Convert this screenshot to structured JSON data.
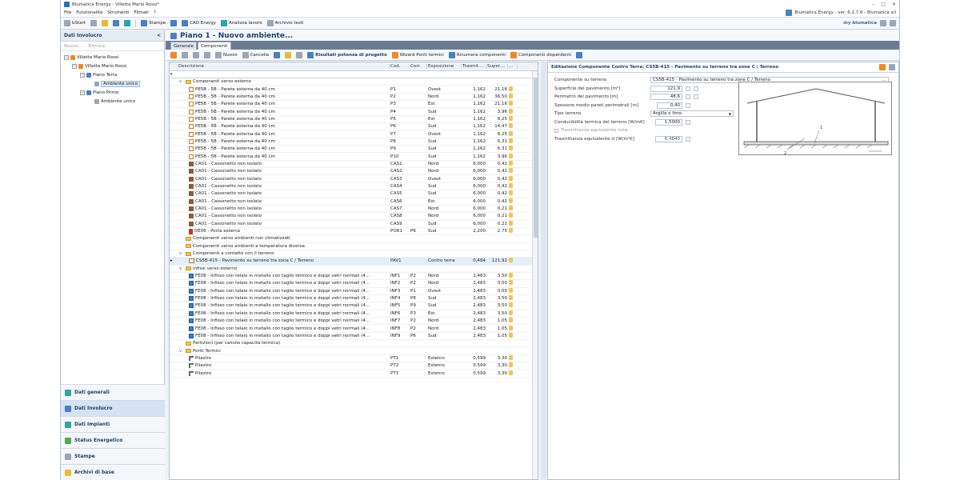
{
  "window": {
    "title": "Blumatica Energy - Villetta Mario Rossi*",
    "controls": [
      "–",
      "□",
      "✕"
    ]
  },
  "menu": {
    "items": [
      "File",
      "Funzionalità",
      "Strumenti",
      "Filmati",
      "?"
    ],
    "version": "Blumatica Energy - ver. 6.2.7.6 - Blumatica srl"
  },
  "toolbar": {
    "start": "bStart",
    "stampe": "Stampe",
    "cad": "CAD Energy",
    "analizza": "Analizza lavoro",
    "archivio": "Archivio testi",
    "brand": "my blumatica"
  },
  "left": {
    "header": "Dati Involucro",
    "collapse": "<",
    "nuovo": "Nuovo...",
    "elimina": "Elimina",
    "tree": [
      {
        "label": "Villetta Mario Rossi",
        "level": 0,
        "exp": "−"
      },
      {
        "label": "Villetta Mario Rossi",
        "level": 1,
        "exp": "−"
      },
      {
        "label": "Piano Terra",
        "level": 2,
        "exp": "−"
      },
      {
        "label": "Ambiente unico",
        "level": 3,
        "exp": "",
        "selected": true
      },
      {
        "label": "Piano Primo",
        "level": 2,
        "exp": "−"
      },
      {
        "label": "Ambiente unico",
        "level": 3,
        "exp": ""
      }
    ],
    "nav": [
      "Dati generali",
      "Dati Involucro",
      "Dati Impianti",
      "Status Energetico",
      "Stampe",
      "Archivi di base"
    ],
    "nav_active": 1
  },
  "main": {
    "title": "Piano 1 - Nuovo ambiente...",
    "tabs": [
      "Generale",
      "Componenti"
    ],
    "active_tab": 1,
    "toolbar": [
      "Nuovo",
      "Cancella",
      "Risultati potenza di progetto",
      "Wizard Ponti termici",
      "Rinumera componenti",
      "Componenti disperdenti"
    ]
  },
  "grid": {
    "headers": [
      "Descrizione",
      "Cod.",
      "Corr.",
      "Esposizione",
      "Trasmit....",
      "Super....",
      "..."
    ],
    "rows": [
      {
        "type": "group",
        "exp": "v",
        "desc": "Componenti verso esterno"
      },
      {
        "type": "wall",
        "desc": "PE5B - 5B - Parete esterna da 40 cm",
        "cod": "P1",
        "corr": "",
        "esp": "Ovest",
        "tr": "1,162",
        "sup": "21,16"
      },
      {
        "type": "wall",
        "desc": "PE5B - 5B - Parete esterna da 40 cm",
        "cod": "P2",
        "corr": "",
        "esp": "Nord",
        "tr": "1,162",
        "sup": "36,50"
      },
      {
        "type": "wall",
        "desc": "PE5B - 5B - Parete esterna da 40 cm",
        "cod": "P3",
        "corr": "",
        "esp": "Est",
        "tr": "1,162",
        "sup": "21,16"
      },
      {
        "type": "wall",
        "desc": "PE5B - 5B - Parete esterna da 40 cm",
        "cod": "P4",
        "corr": "",
        "esp": "Sud",
        "tr": "1,162",
        "sup": "3,96"
      },
      {
        "type": "wall",
        "desc": "PE5B - 5B - Parete esterna da 40 cm",
        "cod": "P5",
        "corr": "",
        "esp": "Est",
        "tr": "1,162",
        "sup": "8,25"
      },
      {
        "type": "wall",
        "desc": "PE5B - 5B - Parete esterna da 40 cm",
        "cod": "P6",
        "corr": "",
        "esp": "Sud",
        "tr": "1,162",
        "sup": "14,47"
      },
      {
        "type": "wall",
        "desc": "PE5B - 5B - Parete esterna da 40 cm",
        "cod": "P7",
        "corr": "",
        "esp": "Ovest",
        "tr": "1,162",
        "sup": "8,25"
      },
      {
        "type": "wall",
        "desc": "PE5B - 5B - Parete esterna da 40 cm",
        "cod": "P8",
        "corr": "",
        "esp": "Sud",
        "tr": "1,162",
        "sup": "6,31"
      },
      {
        "type": "wall",
        "desc": "PE5B - 5B - Parete esterna da 40 cm",
        "cod": "P9",
        "corr": "",
        "esp": "Sud",
        "tr": "1,162",
        "sup": "6,31"
      },
      {
        "type": "wall",
        "desc": "PE5B - 5B - Parete esterna da 40 cm",
        "cod": "P10",
        "corr": "",
        "esp": "Sud",
        "tr": "1,162",
        "sup": "3,96"
      },
      {
        "type": "box",
        "desc": "CA01 - Cassonetto non isolato",
        "cod": "CAS1",
        "corr": "",
        "esp": "Nord",
        "tr": "6,000",
        "sup": "0,42"
      },
      {
        "type": "box",
        "desc": "CA01 - Cassonetto non isolato",
        "cod": "CAS2",
        "corr": "",
        "esp": "Nord",
        "tr": "6,000",
        "sup": "0,42"
      },
      {
        "type": "box",
        "desc": "CA01 - Cassonetto non isolato",
        "cod": "CAS3",
        "corr": "",
        "esp": "Ovest",
        "tr": "6,000",
        "sup": "0,42"
      },
      {
        "type": "box",
        "desc": "CA01 - Cassonetto non isolato",
        "cod": "CAS4",
        "corr": "",
        "esp": "Sud",
        "tr": "6,000",
        "sup": "0,42"
      },
      {
        "type": "box",
        "desc": "CA01 - Cassonetto non isolato",
        "cod": "CAS5",
        "corr": "",
        "esp": "Sud",
        "tr": "6,000",
        "sup": "0,42"
      },
      {
        "type": "box",
        "desc": "CA01 - Cassonetto non isolato",
        "cod": "CAS6",
        "corr": "",
        "esp": "Est",
        "tr": "6,000",
        "sup": "0,42"
      },
      {
        "type": "box",
        "desc": "CA01 - Cassonetto non isolato",
        "cod": "CAS7",
        "corr": "",
        "esp": "Nord",
        "tr": "6,000",
        "sup": "0,21"
      },
      {
        "type": "box",
        "desc": "CA01 - Cassonetto non isolato",
        "cod": "CAS8",
        "corr": "",
        "esp": "Nord",
        "tr": "6,000",
        "sup": "0,21"
      },
      {
        "type": "box",
        "desc": "CA01 - Cassonetto non isolato",
        "cod": "CAS9",
        "corr": "",
        "esp": "Sud",
        "tr": "6,000",
        "sup": "0,21"
      },
      {
        "type": "door",
        "desc": "DE06 - Porta esterna",
        "cod": "POR1",
        "corr": "P6",
        "esp": "Sud",
        "tr": "2,200",
        "sup": "2,75"
      },
      {
        "type": "group",
        "exp": "",
        "desc": "Componenti verso ambienti non climatizzati"
      },
      {
        "type": "group",
        "exp": "",
        "desc": "Componenti verso ambienti a temperatura diversa"
      },
      {
        "type": "group",
        "exp": "v",
        "desc": "Componenti a contatto con il terreno"
      },
      {
        "type": "floor",
        "selected": true,
        "desc": "CS5B-415 - Pavimento su terreno tra zone C / Terreno",
        "cod": "PAV1",
        "corr": "",
        "esp": "Contro terra",
        "tr": "0,484",
        "sup": "121,92"
      },
      {
        "type": "group",
        "exp": "v",
        "desc": "Infissi verso esterno"
      },
      {
        "type": "win",
        "desc": "FE08 - Infisso con telaio in metallo con taglio termico e doppi vetri normali (4...",
        "cod": "INF1",
        "corr": "P2",
        "esp": "Nord",
        "tr": "2,483",
        "sup": "3,50"
      },
      {
        "type": "win",
        "desc": "FE08 - Infisso con telaio in metallo con taglio termico e doppi vetri normali (4...",
        "cod": "INF2",
        "corr": "P2",
        "esp": "Nord",
        "tr": "2,483",
        "sup": "3,50"
      },
      {
        "type": "win",
        "desc": "FE08 - Infisso con telaio in metallo con taglio termico e doppi vetri normali (4...",
        "cod": "INF3",
        "corr": "P1",
        "esp": "Ovest",
        "tr": "2,483",
        "sup": "3,50"
      },
      {
        "type": "win",
        "desc": "FE08 - Infisso con telaio in metallo con taglio termico e doppi vetri normali (4...",
        "cod": "INF4",
        "corr": "P8",
        "esp": "Sud",
        "tr": "2,483",
        "sup": "3,50"
      },
      {
        "type": "win",
        "desc": "FE08 - Infisso con telaio in metallo con taglio termico e doppi vetri normali (4...",
        "cod": "INF5",
        "corr": "P9",
        "esp": "Sud",
        "tr": "2,483",
        "sup": "3,50"
      },
      {
        "type": "win",
        "desc": "FE08 - Infisso con telaio in metallo con taglio termico e doppi vetri normali (4...",
        "cod": "INF6",
        "corr": "P3",
        "esp": "Est",
        "tr": "2,483",
        "sup": "3,50"
      },
      {
        "type": "win",
        "desc": "FE08 - Infisso con telaio in metallo con taglio termico e doppi vetri normali (4...",
        "cod": "INF7",
        "corr": "P2",
        "esp": "Nord",
        "tr": "2,483",
        "sup": "1,05"
      },
      {
        "type": "win",
        "desc": "FE08 - Infisso con telaio in metallo con taglio termico e doppi vetri normali (4...",
        "cod": "INF8",
        "corr": "P2",
        "esp": "Nord",
        "tr": "2,483",
        "sup": "1,05"
      },
      {
        "type": "win",
        "desc": "FE08 - Infisso con telaio in metallo con taglio termico e doppi vetri normali (4...",
        "cod": "INF9",
        "corr": "P6",
        "esp": "Sud",
        "tr": "2,483",
        "sup": "1,05"
      },
      {
        "type": "group",
        "exp": "",
        "desc": "Partizioni (per calcolo capacità termica)"
      },
      {
        "type": "group",
        "exp": "v",
        "desc": "Ponti Termici"
      },
      {
        "type": "pil",
        "desc": "Pilastro",
        "cod": "PT1",
        "corr": "",
        "esp": "Esterno",
        "tr": "0,599",
        "sup": "3,30"
      },
      {
        "type": "pil",
        "desc": "Pilastro",
        "cod": "PT2",
        "corr": "",
        "esp": "Esterno",
        "tr": "0,599",
        "sup": "3,30"
      },
      {
        "type": "pil",
        "desc": "Pilastro",
        "cod": "PT3",
        "corr": "",
        "esp": "Esterno",
        "tr": "0,599",
        "sup": "3,30"
      }
    ]
  },
  "panel": {
    "title": "Editazione Componente Contro Terra: CS5B-415 - Pavimento su terreno tra zone C / Terreno",
    "fields": {
      "componente_label": "Componente su terreno",
      "componente_value": "CS5B-415 - Pavimento su terreno tra zone C / Terreno",
      "superficie_label": "Superficie del pavimento [m²]",
      "superficie_value": "121,9",
      "perimetro_label": "Perimetro del pavimento [m]",
      "perimetro_value": "48,6",
      "spessore_label": "Spessore medio pareti perimetrali [m]",
      "spessore_value": "0,40",
      "tipo_label": "Tipo terreno",
      "tipo_value": "Argilla o limo",
      "conduc_label": "Conducibilità termica del terreno [W/mK]",
      "conduc_value": "1,5000",
      "trasm_nota_label": "Trasmittanza equivalente nota",
      "trasm_eq_label": "Trasmittanza equivalente U [W/m²K]",
      "trasm_eq_value": "0,4840"
    },
    "diagram_labels": [
      "1",
      "2"
    ]
  }
}
